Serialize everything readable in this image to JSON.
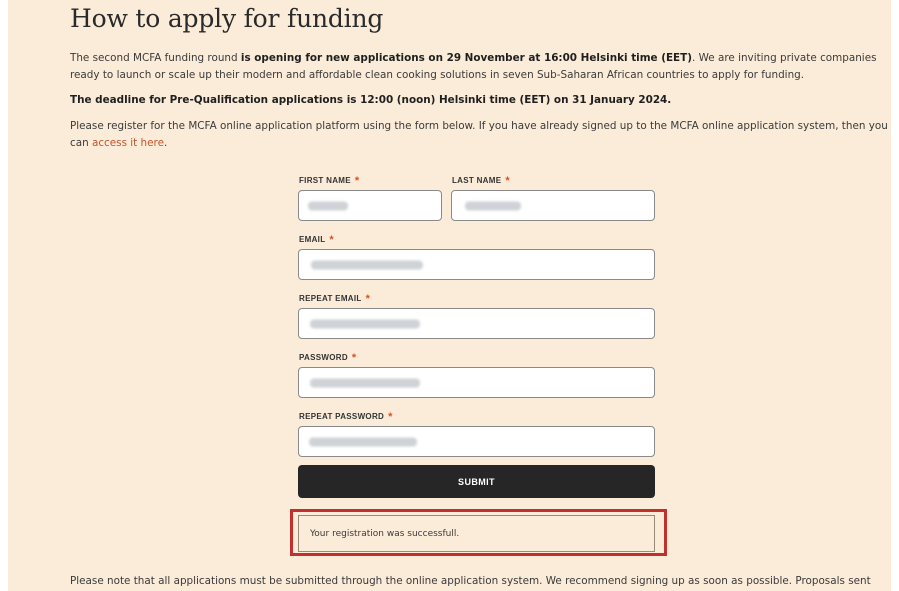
{
  "heading": "How to apply for funding",
  "intro": {
    "part1": "The second MCFA funding round ",
    "bold": "is opening for new applications on 29 November at 16:00 Helsinki time (EET)",
    "part2": ". We are inviting private companies ready to launch or scale up their modern and affordable clean cooking solutions in seven Sub-Saharan African countries to apply for funding."
  },
  "deadline": "The deadline for Pre-Qualification applications is 12:00 (noon) Helsinki time (EET) on 31 January 2024.",
  "register": {
    "text": "Please register for the MCFA online application platform using the form below. If you have already signed up to the MCFA online application system, then you can ",
    "link": "access it here",
    "end": "."
  },
  "form": {
    "required_mark": "*",
    "first_name_label": "FIRST NAME",
    "last_name_label": "LAST NAME",
    "email_label": "EMAIL",
    "repeat_email_label": "REPEAT EMAIL",
    "password_label": "PASSWORD",
    "repeat_password_label": "REPEAT PASSWORD",
    "submit_label": "SUBMIT"
  },
  "success_message": "Your registration was successfull.",
  "footer_note": "Please note that all applications must be submitted through the online application system. We recommend signing up as soon as possible. Proposals sent"
}
